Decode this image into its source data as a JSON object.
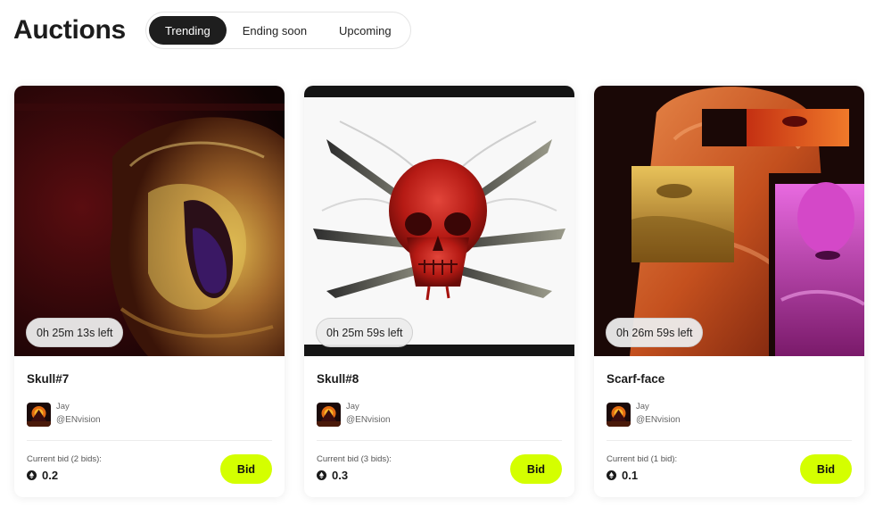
{
  "page": {
    "title": "Auctions"
  },
  "tabs": [
    {
      "label": "Trending",
      "active": true
    },
    {
      "label": "Ending soon",
      "active": false
    },
    {
      "label": "Upcoming",
      "active": false
    }
  ],
  "cards": [
    {
      "title": "Skull#7",
      "time_left": "0h 25m 13s left",
      "creator_name": "Jay",
      "creator_handle": "@ENvision",
      "bid_label": "Current bid (2 bids):",
      "bid_amount": "0.2",
      "bid_button": "Bid"
    },
    {
      "title": "Skull#8",
      "time_left": "0h 25m 59s left",
      "creator_name": "Jay",
      "creator_handle": "@ENvision",
      "bid_label": "Current bid (3 bids):",
      "bid_amount": "0.3",
      "bid_button": "Bid"
    },
    {
      "title": "Scarf-face",
      "time_left": "0h 26m 59s left",
      "creator_name": "Jay",
      "creator_handle": "@ENvision",
      "bid_label": "Current bid (1 bid):",
      "bid_amount": "0.1",
      "bid_button": "Bid"
    }
  ],
  "colors": {
    "accent": "#d4ff00",
    "active_tab": "#1e1e1e"
  },
  "icons": {
    "currency": "eth-icon"
  }
}
